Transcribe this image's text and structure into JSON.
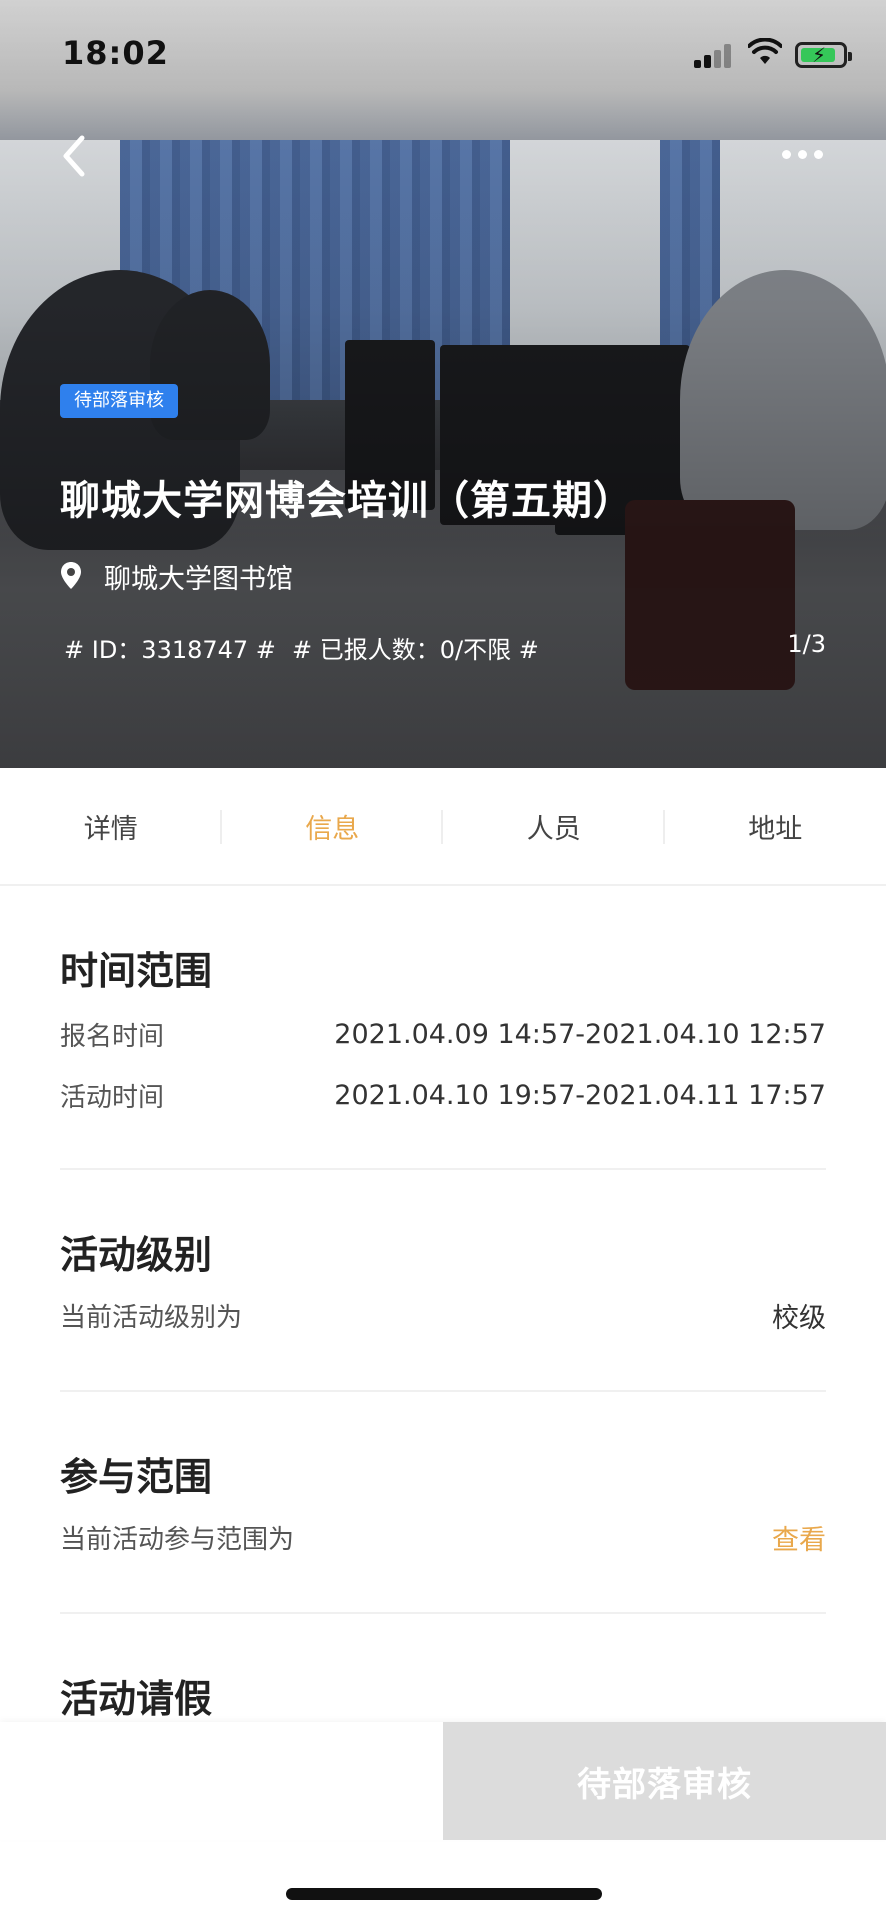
{
  "status_bar": {
    "time": "18:02"
  },
  "hero": {
    "badge": "待部落审核",
    "title": "聊城大学网博会培训（第五期）",
    "location": "聊城大学图书馆",
    "id_text": "# ID：3318747 #",
    "count_text": "# 已报人数：0/不限 #",
    "page_indicator": "1/3"
  },
  "tabs": [
    {
      "label": "详情"
    },
    {
      "label": "信息"
    },
    {
      "label": "人员"
    },
    {
      "label": "地址"
    }
  ],
  "active_tab": "信息",
  "colors": {
    "accent": "#e9a84c",
    "badge": "#2f80ed",
    "disabled": "#dcdcdc"
  },
  "sections": {
    "time_range": {
      "title": "时间范围",
      "rows": [
        {
          "label": "报名时间",
          "value": "2021.04.09 14:57-2021.04.10 12:57"
        },
        {
          "label": "活动时间",
          "value": "2021.04.10 19:57-2021.04.11 17:57"
        }
      ]
    },
    "level": {
      "title": "活动级别",
      "label": "当前活动级别为",
      "value": "校级"
    },
    "scope": {
      "title": "参与范围",
      "label": "当前活动参与范围为",
      "link": "查看"
    },
    "leave": {
      "title": "活动请假"
    }
  },
  "bottom": {
    "action_label": "待部落审核"
  }
}
